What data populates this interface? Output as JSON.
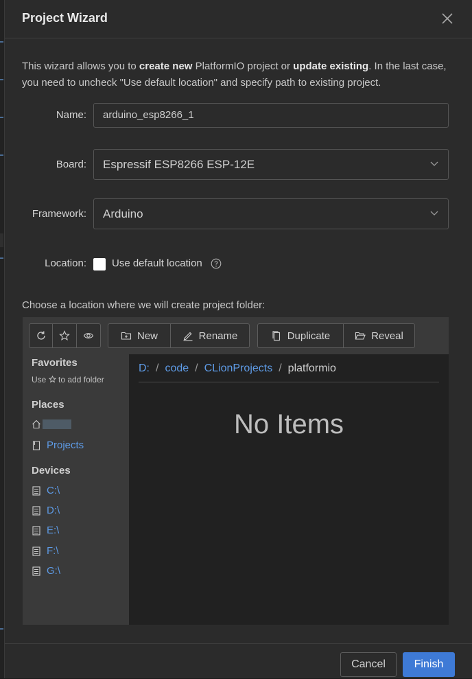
{
  "dialog": {
    "title": "Project Wizard"
  },
  "intro": {
    "p1": "This wizard allows you to ",
    "b1": "create new",
    "p2": " PlatformIO project or ",
    "b2": "update existing",
    "p3": ". In the last case, you need to uncheck \"Use default location\" and specify path to existing project."
  },
  "form": {
    "name_label": "Name:",
    "name_value": "arduino_esp8266_1",
    "board_label": "Board:",
    "board_value": "Espressif ESP8266 ESP-12E",
    "framework_label": "Framework:",
    "framework_value": "Arduino",
    "location_label": "Location:",
    "use_default_label": "Use default location",
    "use_default_checked": false
  },
  "browser": {
    "choose_text": "Choose a location where we will create project folder:",
    "toolbar": {
      "new": "New",
      "rename": "Rename",
      "duplicate": "Duplicate",
      "reveal": "Reveal"
    },
    "sidebar": {
      "favorites_title": "Favorites",
      "favorites_hint_pre": "Use",
      "favorites_hint_post": "to add folder",
      "places_title": "Places",
      "places": [
        "Projects"
      ],
      "devices_title": "Devices",
      "devices": [
        "C:\\",
        "D:\\",
        "E:\\",
        "F:\\",
        "G:\\"
      ]
    },
    "breadcrumb": [
      "D:",
      "code",
      "CLionProjects",
      "platformio"
    ],
    "empty_text": "No Items"
  },
  "footer": {
    "cancel": "Cancel",
    "finish": "Finish"
  },
  "colors": {
    "accent": "#3e7ad6",
    "link": "#5e9be6",
    "dialog_bg": "#2b2b2b"
  }
}
